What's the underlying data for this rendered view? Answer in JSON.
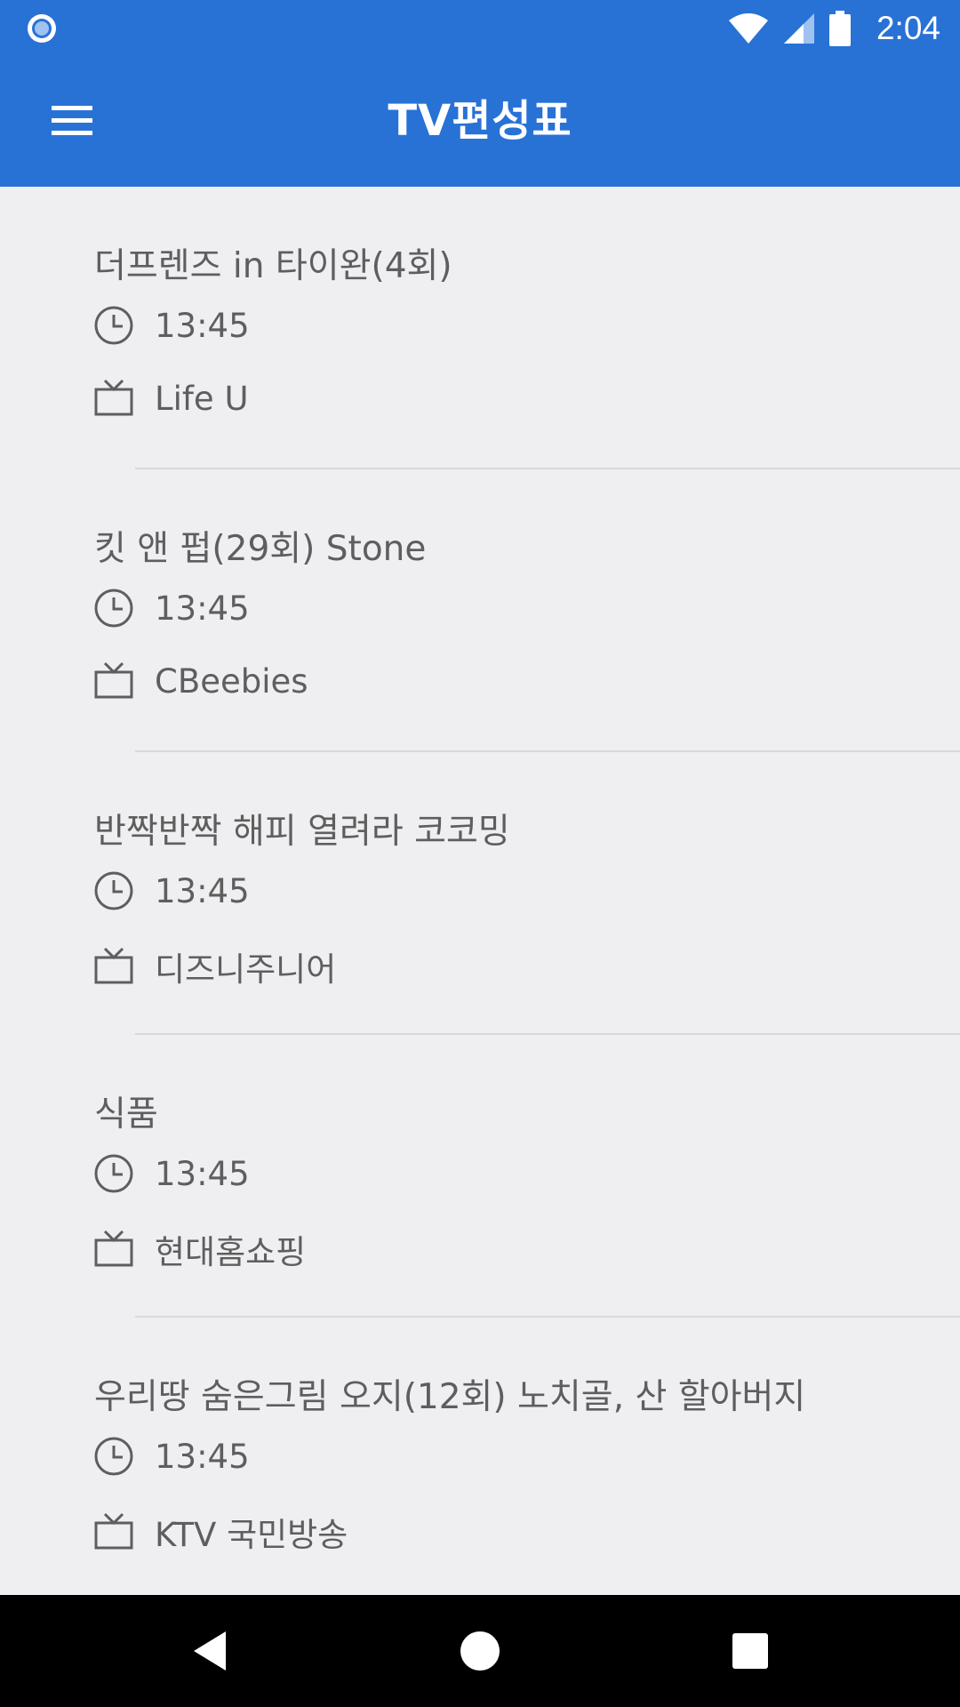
{
  "status_bar": {
    "time": "2:04"
  },
  "app_bar": {
    "title": "TV편성표"
  },
  "programs": [
    {
      "title": "더프렌즈 in 타이완(4회)",
      "time": "13:45",
      "channel": "Life U"
    },
    {
      "title": "킷 앤 펍(29회) Stone",
      "time": "13:45",
      "channel": "CBeebies"
    },
    {
      "title": "반짝반짝 해피 열려라 코코밍",
      "time": "13:45",
      "channel": "디즈니주니어"
    },
    {
      "title": "식품",
      "time": "13:45",
      "channel": "현대홈쇼핑"
    },
    {
      "title": "우리땅 숨은그림 오지(12회) 노치골, 산 할아버지",
      "time": "13:45",
      "channel": "KTV 국민방송"
    }
  ],
  "icons": {
    "menu": "hamburger-menu-icon",
    "time": "clock-icon",
    "channel": "tv-icon",
    "back": "back-triangle-icon",
    "home": "home-circle-icon",
    "recents": "recents-square-icon"
  },
  "colors": {
    "primary": "#2872d6",
    "background": "#efeef1",
    "text": "#5e5e5e",
    "divider": "#d9d9dc"
  }
}
